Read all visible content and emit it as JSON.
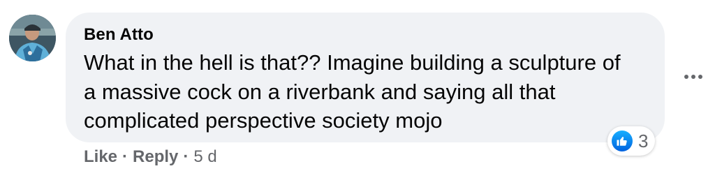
{
  "comment": {
    "author": "Ben Atto",
    "text_lines": [
      "What in the hell is that?? Imagine building a sculpture of",
      "a massive cock on a riverbank and saying all that",
      "complicated perspective society mojo"
    ],
    "reactions": {
      "icon": "thumbs-up-icon",
      "count": "3",
      "color": "#1877f2"
    },
    "actions": {
      "like_label": "Like",
      "reply_label": "Reply",
      "separator": "·",
      "timestamp": "5 d"
    },
    "more_icon": "ellipsis-icon"
  },
  "colors": {
    "bubble_bg": "#f0f2f5",
    "text": "#050505",
    "secondary_text": "#65676b"
  }
}
